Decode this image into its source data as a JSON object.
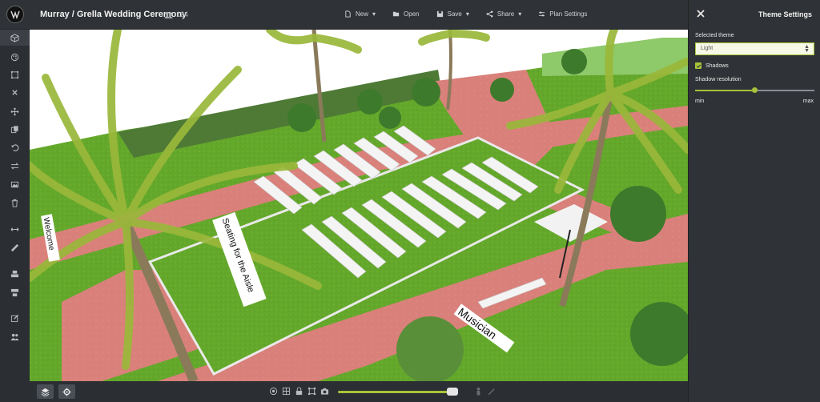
{
  "topbar": {
    "title": "Murray / Grella Wedding Ceremony",
    "guest_count": "124",
    "menu": [
      {
        "label": "New",
        "icon": "file-icon",
        "dropdown": true
      },
      {
        "label": "Open",
        "icon": "folder-icon",
        "dropdown": false
      },
      {
        "label": "Save",
        "icon": "save-icon",
        "dropdown": true
      },
      {
        "label": "Share",
        "icon": "share-icon",
        "dropdown": true
      },
      {
        "label": "Plan Settings",
        "icon": "settings-icon",
        "dropdown": false
      }
    ]
  },
  "sidebar": {
    "tools": [
      "cube-icon",
      "palette-icon",
      "select-area-icon",
      "close-icon",
      "move-icon",
      "copy-icon",
      "undo-icon",
      "swap-icon",
      "image-icon",
      "trash-icon",
      "width-icon",
      "ruler-icon",
      "align-top-icon",
      "align-bottom-icon",
      "edit-icon",
      "group-icon"
    ],
    "active_index": 0
  },
  "viewport": {
    "signs": [
      "Welcome",
      "Seating for the Aisle",
      "Musician"
    ]
  },
  "bottombar": {
    "buttons": [
      "layers-icon",
      "gear-icon"
    ],
    "icons": [
      "target-icon",
      "grid-icon",
      "lock-icon",
      "frame-icon",
      "camera-icon",
      "person-icon",
      "pen-icon"
    ],
    "zoom_level": 0.95
  },
  "panel": {
    "title": "Theme Settings",
    "theme_label": "Selected theme",
    "theme_value": "Light",
    "shadows_label": "Shadows",
    "shadows_checked": true,
    "resolution_label": "Shadow resolution",
    "resolution_value": 0.5,
    "min_label": "min",
    "max_label": "max"
  },
  "colors": {
    "accent": "#a8c33a",
    "path": "#d77a72",
    "grass": "#62a528",
    "chrome": "#2f3236"
  }
}
